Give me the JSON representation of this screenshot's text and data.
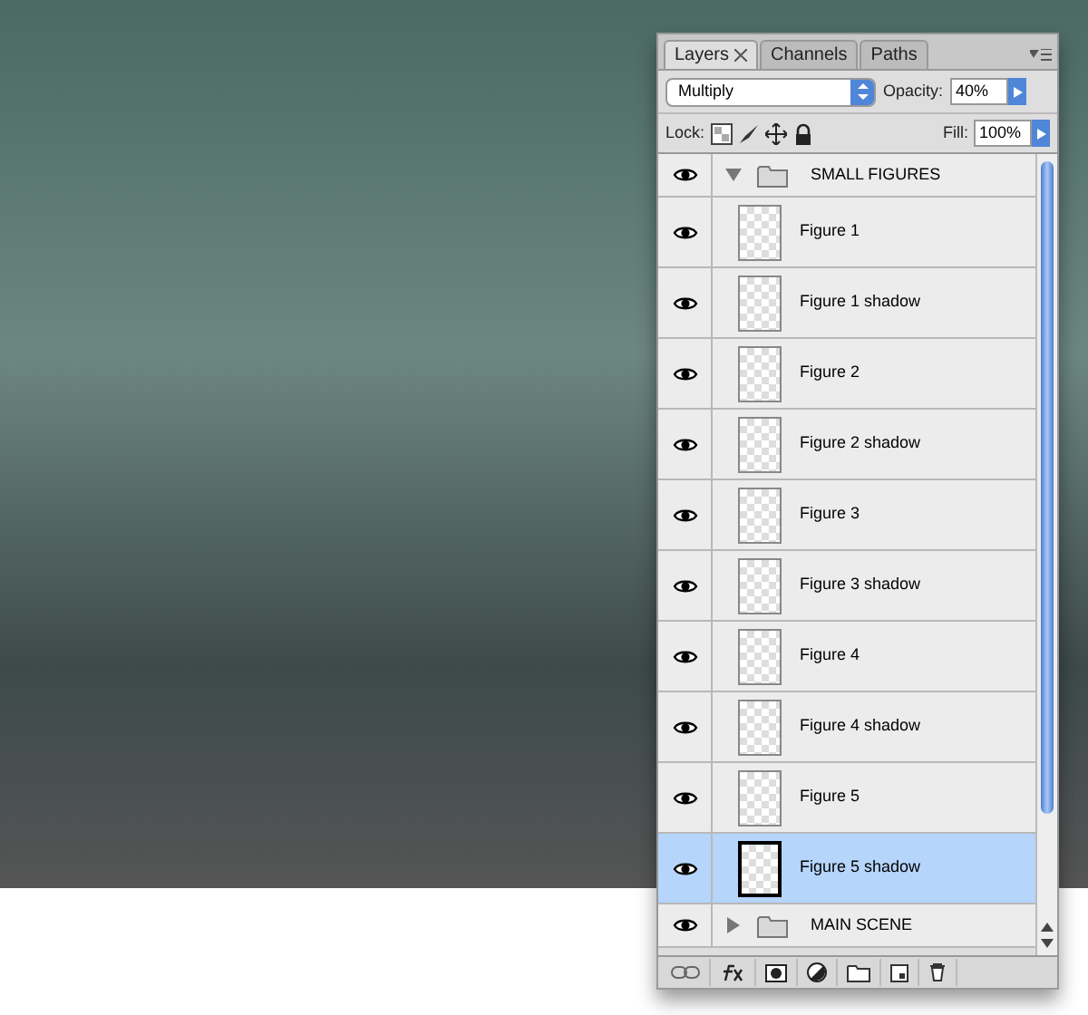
{
  "panel": {
    "tabs": [
      {
        "label": "Layers",
        "selected": true,
        "closable": true
      },
      {
        "label": "Channels",
        "selected": false,
        "closable": false
      },
      {
        "label": "Paths",
        "selected": false,
        "closable": false
      }
    ],
    "blend_mode": "Multiply",
    "opacity_label": "Opacity:",
    "opacity": "40%",
    "lock_label": "Lock:",
    "fill_label": "Fill:",
    "fill": "100%",
    "layers": [
      {
        "kind": "group",
        "name": "SMALL FIGURES",
        "visible": true,
        "expanded": true,
        "selected": false,
        "children": [
          {
            "kind": "layer",
            "name": "Figure 1",
            "visible": true,
            "selected": false
          },
          {
            "kind": "layer",
            "name": "Figure 1 shadow",
            "visible": true,
            "selected": false
          },
          {
            "kind": "layer",
            "name": "Figure 2",
            "visible": true,
            "selected": false
          },
          {
            "kind": "layer",
            "name": "Figure 2 shadow",
            "visible": true,
            "selected": false
          },
          {
            "kind": "layer",
            "name": "Figure 3",
            "visible": true,
            "selected": false
          },
          {
            "kind": "layer",
            "name": "Figure 3 shadow",
            "visible": true,
            "selected": false
          },
          {
            "kind": "layer",
            "name": "Figure 4",
            "visible": true,
            "selected": false
          },
          {
            "kind": "layer",
            "name": "Figure 4 shadow",
            "visible": true,
            "selected": false
          },
          {
            "kind": "layer",
            "name": "Figure 5",
            "visible": true,
            "selected": false
          },
          {
            "kind": "layer",
            "name": "Figure 5 shadow",
            "visible": true,
            "selected": true
          }
        ]
      },
      {
        "kind": "group",
        "name": "MAIN SCENE",
        "visible": true,
        "expanded": false,
        "selected": false
      }
    ]
  }
}
